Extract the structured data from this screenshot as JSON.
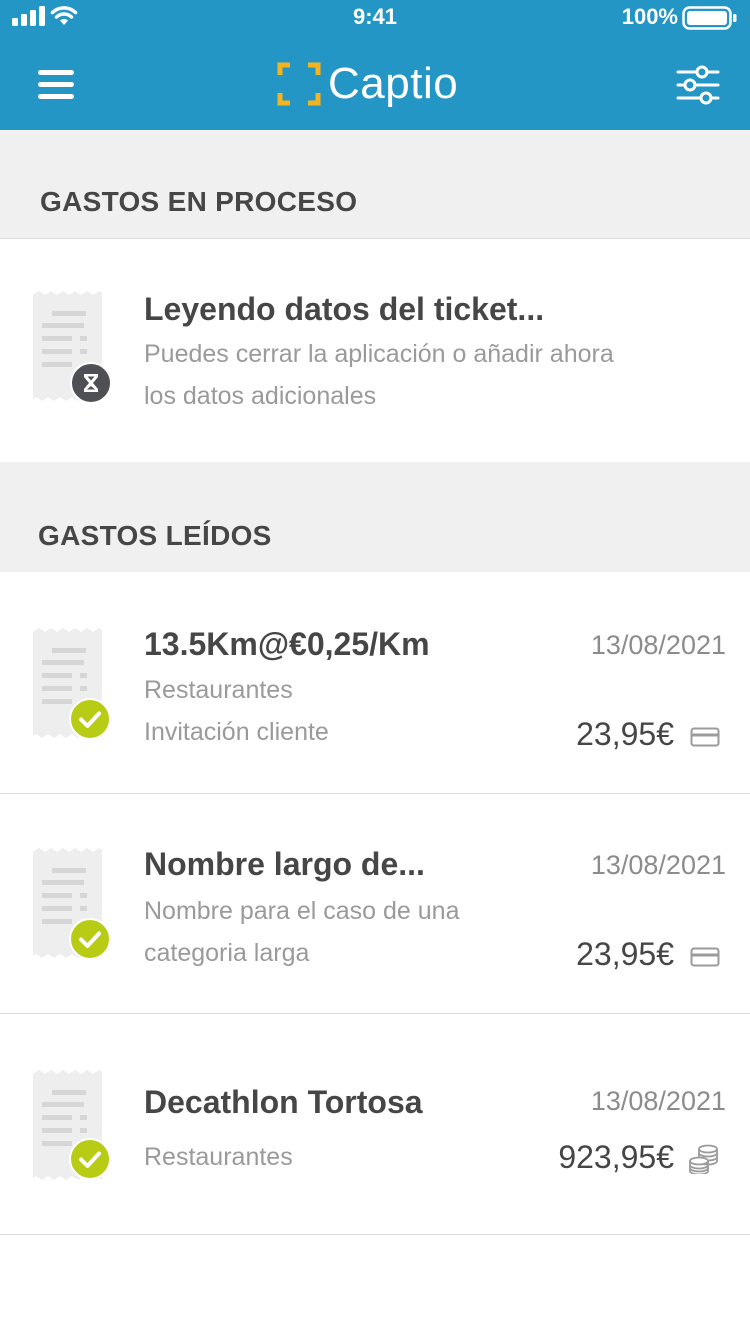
{
  "status_bar": {
    "time": "9:41",
    "battery": "100%"
  },
  "header": {
    "app_name": "Captio",
    "accent_color": "#2496c5",
    "logo_color": "#f5b41e"
  },
  "sections": {
    "in_process": {
      "title": "GASTOS EN PROCESO",
      "item": {
        "title": "Leyendo datos del ticket...",
        "line1": "Puedes cerrar la aplicación o añadir ahora",
        "line2": "los datos adicionales",
        "status_icon": "hourglass-icon"
      }
    },
    "read": {
      "title": "GASTOS LEÍDOS",
      "items": [
        {
          "title": "13.5Km@€0,25/Km",
          "line1": "Restaurantes",
          "line2": "Invitación cliente",
          "date": "13/08/2021",
          "amount": "23,95€",
          "payment_icon": "card-icon",
          "status_icon": "check-icon"
        },
        {
          "title": "Nombre largo de...",
          "line1": "Nombre para el caso de una",
          "line2": "categoria larga",
          "date": "13/08/2021",
          "amount": "23,95€",
          "payment_icon": "card-icon",
          "status_icon": "check-icon"
        },
        {
          "title": "Decathlon Tortosa",
          "line1": "Restaurantes",
          "date": "13/08/2021",
          "amount": "923,95€",
          "payment_icon": "cash-icon",
          "status_icon": "check-icon"
        }
      ]
    }
  }
}
